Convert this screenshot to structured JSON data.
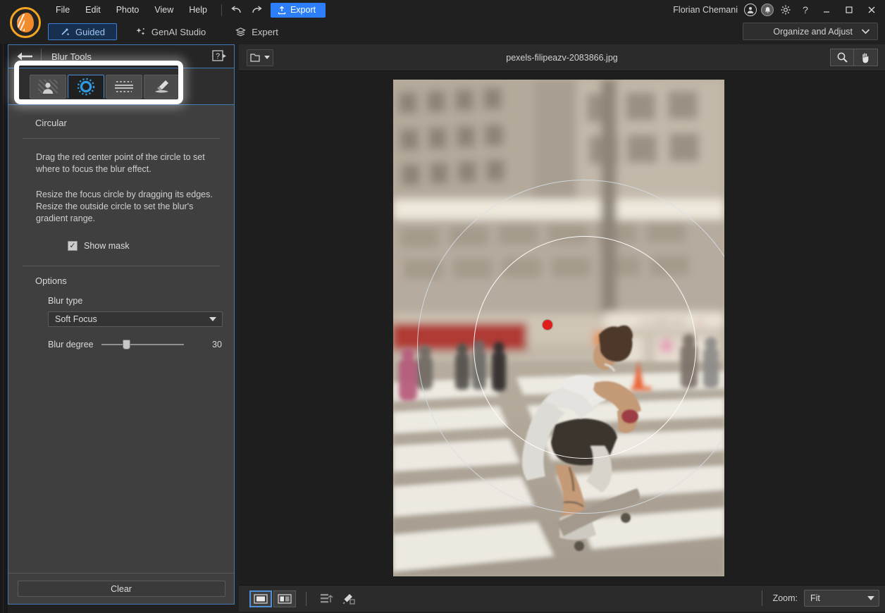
{
  "app": {
    "logo_icon": "photo-app-logo-icon",
    "menus": [
      "File",
      "Edit",
      "Photo",
      "View",
      "Help"
    ],
    "undo_icon": "undo-arrow-icon",
    "redo_icon": "redo-arrow-icon",
    "export_label": "Export",
    "export_icon": "upload-icon",
    "export_color": "#2d7ff9",
    "user_name": "Florian Chemani",
    "account_icon": "account-avatar-icon",
    "notification_icon": "bell-icon",
    "settings_icon": "gear-icon",
    "help_icon": "question-mark-icon",
    "minimize_label": "—",
    "maximize_label": "☐",
    "close_label": "✕"
  },
  "modes": {
    "tabs": [
      {
        "label": "Guided",
        "icon": "magic-wand-icon",
        "active": true
      },
      {
        "label": "GenAI Studio",
        "icon": "sparkle-icon",
        "active": false
      },
      {
        "label": "Expert",
        "icon": "layers-icon",
        "active": false
      }
    ],
    "organize_label": "Organize and Adjust",
    "organize_chevron_icon": "chevron-down-icon"
  },
  "panel": {
    "back_icon": "back-arrow-icon",
    "title": "Blur Tools",
    "help_icon": "help-video-icon",
    "tools": [
      {
        "name": "tool-portrait-blur",
        "icon": "person-blur-icon",
        "active": false
      },
      {
        "name": "tool-circular-blur",
        "icon": "circular-blur-icon",
        "active": true
      },
      {
        "name": "tool-linear-blur",
        "icon": "linear-blur-icon",
        "active": false
      },
      {
        "name": "tool-brush-blur",
        "icon": "brush-blur-icon",
        "active": false
      }
    ],
    "section_title": "Circular",
    "instruction_1": "Drag the red center point of the circle to set where to focus the blur effect.",
    "instruction_2": "Resize the focus circle by dragging its edges. Resize the outside circle to set the blur's gradient range.",
    "show_mask_label": "Show mask",
    "show_mask_checked": true,
    "check_glyph": "✓",
    "options_title": "Options",
    "blur_type_label": "Blur type",
    "blur_type_value": "Soft Focus",
    "blur_degree_label": "Blur degree",
    "blur_degree_value": "30",
    "blur_degree_percent": 30,
    "clear_label": "Clear"
  },
  "canvas": {
    "folder_icon": "open-folder-icon",
    "folder_caret_icon": "caret-down-icon",
    "filename": "pexels-filipeazv-2083866.jpg",
    "zoom_tool_icon": "magnifier-icon",
    "hand_tool_icon": "hand-icon",
    "photo_alt": "skateboarder-crossing-street-photo",
    "overlay_outer_circle": "blur-gradient-circle",
    "overlay_inner_circle": "focus-circle",
    "center_point": "red-center-point",
    "center_point_color": "#e01d1d"
  },
  "footer": {
    "view_single_icon": "single-view-icon",
    "view_before_after_icon": "before-after-view-icon",
    "view_single_active": true,
    "reset_icon": "reset-panel-icon",
    "edit_icon": "pencil-edit-icon",
    "zoom_label": "Zoom:",
    "zoom_value": "Fit",
    "zoom_caret_icon": "caret-down-icon"
  }
}
